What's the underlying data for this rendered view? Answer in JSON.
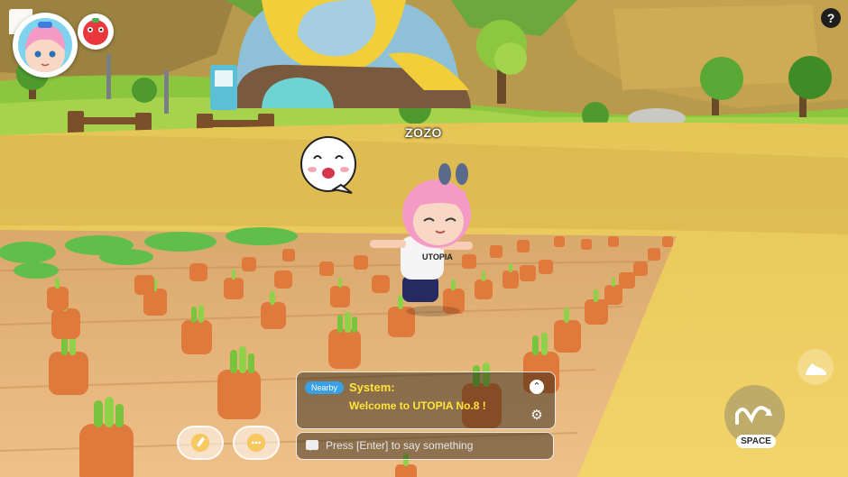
{
  "hud": {
    "player_name": "ZOZO",
    "help_label": "?"
  },
  "chat": {
    "channel_badge": "Nearby",
    "system_label": "System:",
    "system_message": "Welcome to UTOPIA No.8 !",
    "input_placeholder": "Press [Enter] to say something",
    "collapse_glyph": "⌃",
    "settings_glyph": "⚙"
  },
  "controls": {
    "jump_key_label": "SPACE"
  },
  "scene": {
    "shirt_text": "UTOPIA",
    "colors": {
      "sky_grass": "#8cc63f",
      "field": "#e8c65a",
      "soil": "#e7b47a",
      "carrot": "#e07a3c",
      "leaves": "#5fbf4a",
      "system_text": "#ffe43a",
      "nearby_badge": "#39a0e6"
    }
  }
}
